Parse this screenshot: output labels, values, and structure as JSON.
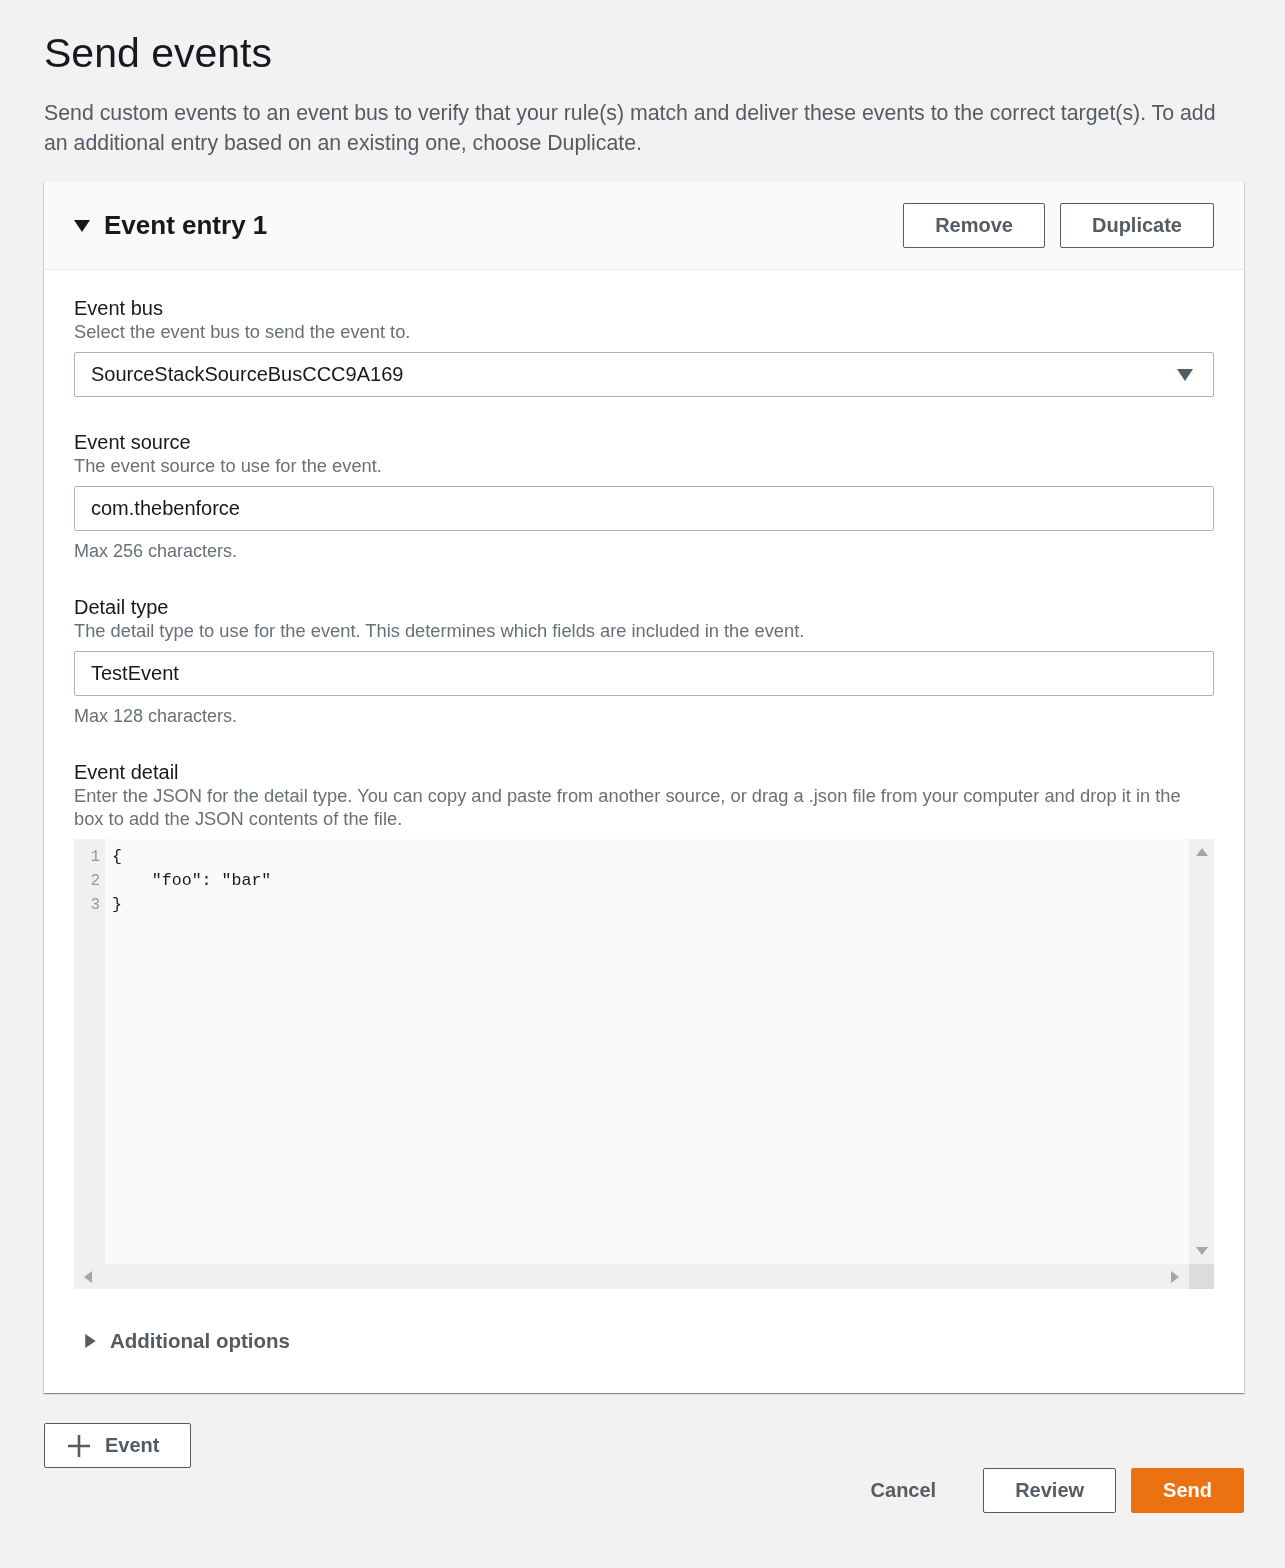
{
  "page": {
    "title": "Send events",
    "description": "Send custom events to an event bus to verify that your rule(s) match and deliver these events to the correct target(s). To add an additional entry based on an existing one, choose Duplicate."
  },
  "event_entry": {
    "title": "Event entry 1",
    "expanded": true,
    "actions": [
      "Remove",
      "Duplicate"
    ],
    "fields": [
      {
        "kind": "select",
        "label": "Event bus",
        "description": "Select the event bus to send the event to.",
        "value": "SourceStackSourceBusCCC9A169"
      },
      {
        "kind": "input",
        "label": "Event source",
        "description": "The event source to use for the event.",
        "value": "com.thebenforce",
        "hint": "Max 256 characters."
      },
      {
        "kind": "input",
        "label": "Detail type",
        "description": "The detail type to use for the event. This determines which fields are included in the event.",
        "value": "TestEvent",
        "hint": "Max 128 characters."
      },
      {
        "kind": "code",
        "label": "Event detail",
        "description": "Enter the JSON for the detail type. You can copy and paste from another source, or drag a .json file from your computer and drop it in the box to add the JSON contents of the file.",
        "lines": [
          {
            "number": "1",
            "text": "{"
          },
          {
            "number": "2",
            "text": "    \"foo\": \"bar\""
          },
          {
            "number": "3",
            "text": "}"
          }
        ]
      }
    ],
    "additional_options": {
      "label": "Additional options",
      "expanded": false
    }
  },
  "add_event_button": {
    "label": "Event"
  },
  "footer": {
    "buttons": [
      {
        "kind": "link",
        "label": "Cancel"
      },
      {
        "kind": "normal",
        "label": "Review"
      },
      {
        "kind": "primary",
        "label": "Send"
      }
    ]
  }
}
